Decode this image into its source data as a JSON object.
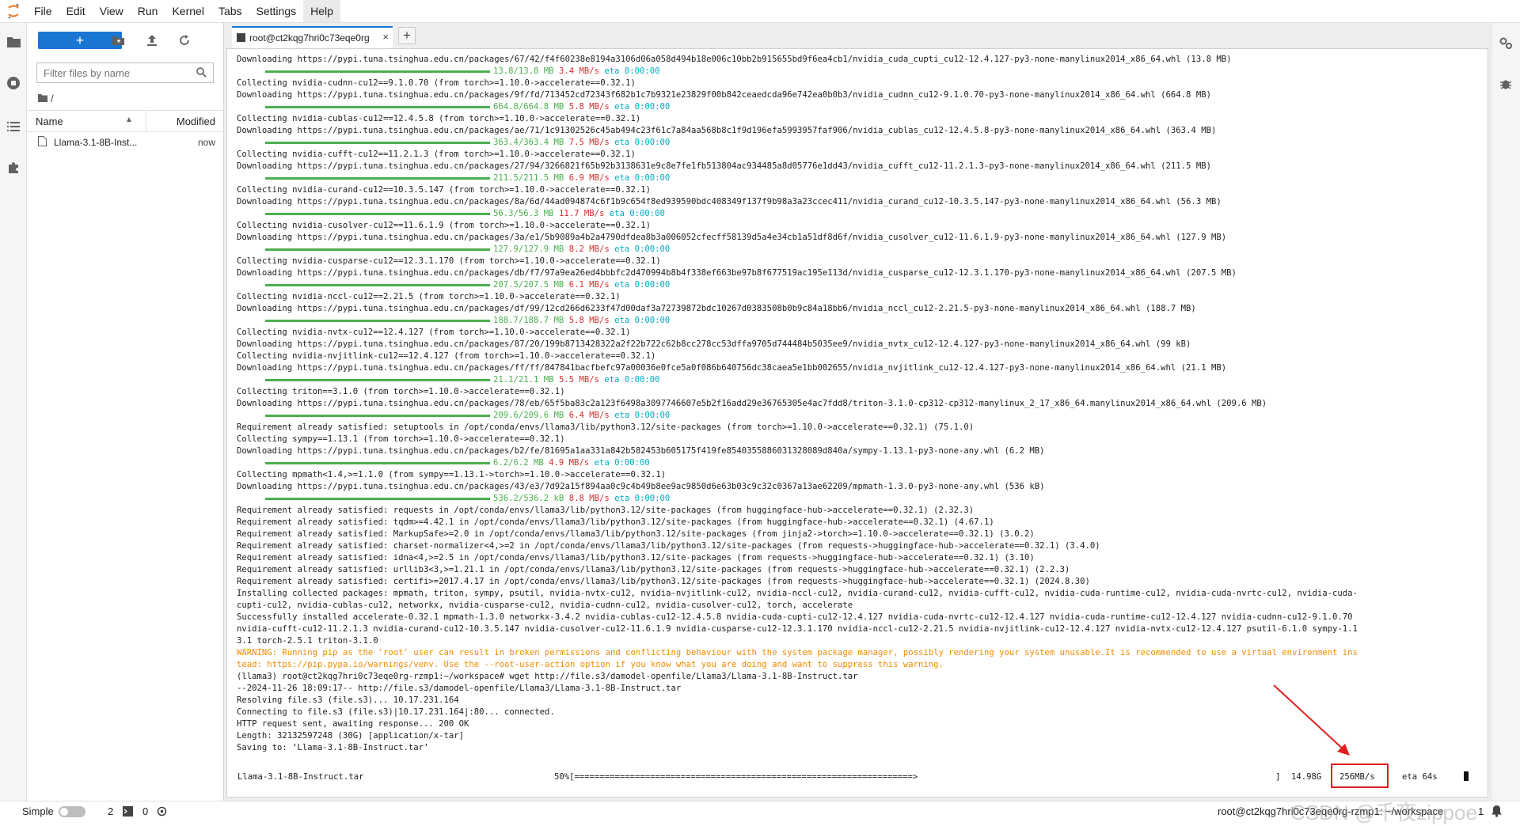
{
  "menu": [
    "File",
    "Edit",
    "View",
    "Run",
    "Kernel",
    "Tabs",
    "Settings",
    "Help"
  ],
  "menu_active": "Help",
  "filebrowser": {
    "new_label": "+",
    "filter_placeholder": "Filter files by name",
    "breadcrumb": "/",
    "col_name": "Name",
    "col_modified": "Modified",
    "files": [
      {
        "name": "Llama-3.1-8B-Inst...",
        "modified": "now"
      }
    ]
  },
  "tab": {
    "label": "root@ct2kqg7hri0c73eqe0rg",
    "close": "×",
    "add": "+"
  },
  "terminal": {
    "lines": [
      {
        "kind": "t",
        "text": "  Downloading https://pypi.tuna.tsinghua.edu.cn/packages/67/42/f4f60238e8194a3106d06a058d494b18e006c10bb2b915655bd9f6ea4cb1/nvidia_cuda_cupti_cu12-12.4.127-py3-none-manylinux2014_x86_64.whl (13.8 MB)"
      },
      {
        "kind": "bar",
        "size": "13.8/13.8 MB",
        "speed": "3.4 MB/s",
        "eta": "eta 0:00:00"
      },
      {
        "kind": "t",
        "text": "Collecting nvidia-cudnn-cu12==9.1.0.70 (from torch>=1.10.0->accelerate==0.32.1)"
      },
      {
        "kind": "t",
        "text": "  Downloading https://pypi.tuna.tsinghua.edu.cn/packages/9f/fd/713452cd72343f682b1c7b9321e23829f00b842ceaedcda96e742ea0b0b3/nvidia_cudnn_cu12-9.1.0.70-py3-none-manylinux2014_x86_64.whl (664.8 MB)"
      },
      {
        "kind": "bar",
        "size": "664.8/664.8 MB",
        "speed": "5.8 MB/s",
        "eta": "eta 0:00:00"
      },
      {
        "kind": "t",
        "text": "Collecting nvidia-cublas-cu12==12.4.5.8 (from torch>=1.10.0->accelerate==0.32.1)"
      },
      {
        "kind": "t",
        "text": "  Downloading https://pypi.tuna.tsinghua.edu.cn/packages/ae/71/1c91302526c45ab494c23f61c7a84aa568b8c1f9d196efa5993957faf906/nvidia_cublas_cu12-12.4.5.8-py3-none-manylinux2014_x86_64.whl (363.4 MB)"
      },
      {
        "kind": "bar",
        "size": "363.4/363.4 MB",
        "speed": "7.5 MB/s",
        "eta": "eta 0:00:00"
      },
      {
        "kind": "t",
        "text": "Collecting nvidia-cufft-cu12==11.2.1.3 (from torch>=1.10.0->accelerate==0.32.1)"
      },
      {
        "kind": "t",
        "text": "  Downloading https://pypi.tuna.tsinghua.edu.cn/packages/27/94/3266821f65b92b3138631e9c8e7fe1fb513804ac934485a8d05776e1dd43/nvidia_cufft_cu12-11.2.1.3-py3-none-manylinux2014_x86_64.whl (211.5 MB)"
      },
      {
        "kind": "bar",
        "size": "211.5/211.5 MB",
        "speed": "6.9 MB/s",
        "eta": "eta 0:00:00"
      },
      {
        "kind": "t",
        "text": "Collecting nvidia-curand-cu12==10.3.5.147 (from torch>=1.10.0->accelerate==0.32.1)"
      },
      {
        "kind": "t",
        "text": "  Downloading https://pypi.tuna.tsinghua.edu.cn/packages/8a/6d/44ad094874c6f1b9c654f8ed939590bdc408349f137f9b98a3a23ccec411/nvidia_curand_cu12-10.3.5.147-py3-none-manylinux2014_x86_64.whl (56.3 MB)"
      },
      {
        "kind": "bar",
        "size": "56.3/56.3 MB",
        "speed": "11.7 MB/s",
        "eta": "eta 0:00:00"
      },
      {
        "kind": "t",
        "text": "Collecting nvidia-cusolver-cu12==11.6.1.9 (from torch>=1.10.0->accelerate==0.32.1)"
      },
      {
        "kind": "t",
        "text": "  Downloading https://pypi.tuna.tsinghua.edu.cn/packages/3a/e1/5b9089a4b2a4790dfdea8b3a006052cfecff58139d5a4e34cb1a51df8d6f/nvidia_cusolver_cu12-11.6.1.9-py3-none-manylinux2014_x86_64.whl (127.9 MB)"
      },
      {
        "kind": "bar",
        "size": "127.9/127.9 MB",
        "speed": "8.2 MB/s",
        "eta": "eta 0:00:00"
      },
      {
        "kind": "t",
        "text": "Collecting nvidia-cusparse-cu12==12.3.1.170 (from torch>=1.10.0->accelerate==0.32.1)"
      },
      {
        "kind": "t",
        "text": "  Downloading https://pypi.tuna.tsinghua.edu.cn/packages/db/f7/97a9ea26ed4bbbfc2d470994b8b4f338ef663be97b8f677519ac195e113d/nvidia_cusparse_cu12-12.3.1.170-py3-none-manylinux2014_x86_64.whl (207.5 MB)"
      },
      {
        "kind": "bar",
        "size": "207.5/207.5 MB",
        "speed": "6.1 MB/s",
        "eta": "eta 0:00:00"
      },
      {
        "kind": "t",
        "text": "Collecting nvidia-nccl-cu12==2.21.5 (from torch>=1.10.0->accelerate==0.32.1)"
      },
      {
        "kind": "t",
        "text": "  Downloading https://pypi.tuna.tsinghua.edu.cn/packages/df/99/12cd266d6233f47d00daf3a72739872bdc10267d0383508b0b9c84a18bb6/nvidia_nccl_cu12-2.21.5-py3-none-manylinux2014_x86_64.whl (188.7 MB)"
      },
      {
        "kind": "bar",
        "size": "188.7/188.7 MB",
        "speed": "5.8 MB/s",
        "eta": "eta 0:00:00"
      },
      {
        "kind": "t",
        "text": "Collecting nvidia-nvtx-cu12==12.4.127 (from torch>=1.10.0->accelerate==0.32.1)"
      },
      {
        "kind": "t",
        "text": "  Downloading https://pypi.tuna.tsinghua.edu.cn/packages/87/20/199b8713428322a2f22b722c62b8cc278cc53dffa9705d744484b5035ee9/nvidia_nvtx_cu12-12.4.127-py3-none-manylinux2014_x86_64.whl (99 kB)"
      },
      {
        "kind": "t",
        "text": "Collecting nvidia-nvjitlink-cu12==12.4.127 (from torch>=1.10.0->accelerate==0.32.1)"
      },
      {
        "kind": "t",
        "text": "  Downloading https://pypi.tuna.tsinghua.edu.cn/packages/ff/ff/847841bacfbefc97a00036e0fce5a0f086b640756dc38caea5e1bb002655/nvidia_nvjitlink_cu12-12.4.127-py3-none-manylinux2014_x86_64.whl (21.1 MB)"
      },
      {
        "kind": "bar",
        "size": "21.1/21.1 MB",
        "speed": "5.5 MB/s",
        "eta": "eta 0:00:00"
      },
      {
        "kind": "t",
        "text": "Collecting triton==3.1.0 (from torch>=1.10.0->accelerate==0.32.1)"
      },
      {
        "kind": "t",
        "text": "  Downloading https://pypi.tuna.tsinghua.edu.cn/packages/78/eb/65f5ba83c2a123f6498a3097746607e5b2f16add29e36765305e4ac7fdd8/triton-3.1.0-cp312-cp312-manylinux_2_17_x86_64.manylinux2014_x86_64.whl (209.6 MB)"
      },
      {
        "kind": "bar",
        "size": "209.6/209.6 MB",
        "speed": "6.4 MB/s",
        "eta": "eta 0:00:00"
      },
      {
        "kind": "t",
        "text": "Requirement already satisfied: setuptools in /opt/conda/envs/llama3/lib/python3.12/site-packages (from torch>=1.10.0->accelerate==0.32.1) (75.1.0)"
      },
      {
        "kind": "t",
        "text": "Collecting sympy==1.13.1 (from torch>=1.10.0->accelerate==0.32.1)"
      },
      {
        "kind": "t",
        "text": "  Downloading https://pypi.tuna.tsinghua.edu.cn/packages/b2/fe/81695a1aa331a842b582453b605175f419fe8540355886031328089d840a/sympy-1.13.1-py3-none-any.whl (6.2 MB)"
      },
      {
        "kind": "bar",
        "size": "6.2/6.2 MB",
        "speed": "4.9 MB/s",
        "eta": "eta 0:00:00"
      },
      {
        "kind": "t",
        "text": "Collecting mpmath<1.4,>=1.1.0 (from sympy==1.13.1->torch>=1.10.0->accelerate==0.32.1)"
      },
      {
        "kind": "t",
        "text": "  Downloading https://pypi.tuna.tsinghua.edu.cn/packages/43/e3/7d92a15f894aa0c9c4b49b8ee9ac9850d6e63b03c9c32c0367a13ae62209/mpmath-1.3.0-py3-none-any.whl (536 kB)"
      },
      {
        "kind": "bar",
        "size": "536.2/536.2 kB",
        "speed": "8.8 MB/s",
        "eta": "eta 0:00:00"
      },
      {
        "kind": "t",
        "text": "Requirement already satisfied: requests in /opt/conda/envs/llama3/lib/python3.12/site-packages (from huggingface-hub->accelerate==0.32.1) (2.32.3)"
      },
      {
        "kind": "t",
        "text": "Requirement already satisfied: tqdm>=4.42.1 in /opt/conda/envs/llama3/lib/python3.12/site-packages (from huggingface-hub->accelerate==0.32.1) (4.67.1)"
      },
      {
        "kind": "t",
        "text": "Requirement already satisfied: MarkupSafe>=2.0 in /opt/conda/envs/llama3/lib/python3.12/site-packages (from jinja2->torch>=1.10.0->accelerate==0.32.1) (3.0.2)"
      },
      {
        "kind": "t",
        "text": "Requirement already satisfied: charset-normalizer<4,>=2 in /opt/conda/envs/llama3/lib/python3.12/site-packages (from requests->huggingface-hub->accelerate==0.32.1) (3.4.0)"
      },
      {
        "kind": "t",
        "text": "Requirement already satisfied: idna<4,>=2.5 in /opt/conda/envs/llama3/lib/python3.12/site-packages (from requests->huggingface-hub->accelerate==0.32.1) (3.10)"
      },
      {
        "kind": "t",
        "text": "Requirement already satisfied: urllib3<3,>=1.21.1 in /opt/conda/envs/llama3/lib/python3.12/site-packages (from requests->huggingface-hub->accelerate==0.32.1) (2.2.3)"
      },
      {
        "kind": "t",
        "text": "Requirement already satisfied: certifi>=2017.4.17 in /opt/conda/envs/llama3/lib/python3.12/site-packages (from requests->huggingface-hub->accelerate==0.32.1) (2024.8.30)"
      },
      {
        "kind": "t",
        "text": "Installing collected packages: mpmath, triton, sympy, psutil, nvidia-nvtx-cu12, nvidia-nvjitlink-cu12, nvidia-nccl-cu12, nvidia-curand-cu12, nvidia-cufft-cu12, nvidia-cuda-runtime-cu12, nvidia-cuda-nvrtc-cu12, nvidia-cuda-"
      },
      {
        "kind": "t",
        "text": "cupti-cu12, nvidia-cublas-cu12, networkx, nvidia-cusparse-cu12, nvidia-cudnn-cu12, nvidia-cusolver-cu12, torch, accelerate"
      },
      {
        "kind": "t",
        "text": "Successfully installed accelerate-0.32.1 mpmath-1.3.0 networkx-3.4.2 nvidia-cublas-cu12-12.4.5.8 nvidia-cuda-cupti-cu12-12.4.127 nvidia-cuda-nvrtc-cu12-12.4.127 nvidia-cuda-runtime-cu12-12.4.127 nvidia-cudnn-cu12-9.1.0.70"
      },
      {
        "kind": "t",
        "text": "nvidia-cufft-cu12-11.2.1.3 nvidia-curand-cu12-10.3.5.147 nvidia-cusolver-cu12-11.6.1.9 nvidia-cusparse-cu12-12.3.1.170 nvidia-nccl-cu12-2.21.5 nvidia-nvjitlink-cu12-12.4.127 nvidia-nvtx-cu12-12.4.127 psutil-6.1.0 sympy-1.1"
      },
      {
        "kind": "t",
        "text": "3.1 torch-2.5.1 triton-3.1.0"
      },
      {
        "kind": "w",
        "text": "WARNING: Running pip as the 'root' user can result in broken permissions and conflicting behaviour with the system package manager, possibly rendering your system unusable.It is recommended to use a virtual environment ins"
      },
      {
        "kind": "w",
        "text": "tead: https://pip.pypa.io/warnings/venv. Use the --root-user-action option if you know what you are doing and want to suppress this warning."
      },
      {
        "kind": "t",
        "text": "(llama3) root@ct2kqg7hri0c73eqe0rg-rzmp1:~/workspace# wget http://file.s3/damodel-openfile/Llama3/Llama-3.1-8B-Instruct.tar"
      },
      {
        "kind": "t",
        "text": "--2024-11-26 18:09:17--  http://file.s3/damodel-openfile/Llama3/Llama-3.1-8B-Instruct.tar"
      },
      {
        "kind": "t",
        "text": "Resolving file.s3 (file.s3)... 10.17.231.164"
      },
      {
        "kind": "t",
        "text": "Connecting to file.s3 (file.s3)|10.17.231.164|:80... connected."
      },
      {
        "kind": "t",
        "text": "HTTP request sent, awaiting response... 200 OK"
      },
      {
        "kind": "t",
        "text": "Length: 32132597248 (30G) [application/x-tar]"
      },
      {
        "kind": "t",
        "text": "Saving to: ‘Llama-3.1-8B-Instruct.tar’"
      }
    ],
    "progress": {
      "file": "Llama-3.1-8B-Instruct.tar",
      "percent": "50%[===================================================================>",
      "bracket": "]",
      "size": "14.98G",
      "speed": "256MB/s",
      "eta": "eta 64s"
    }
  },
  "statusbar": {
    "mode": "Simple",
    "terminals": "2",
    "kernels": "0",
    "right": "root@ct2kqg7hri0c73eqe0rg-rzmp1: ~/workspace",
    "count": "1"
  },
  "watermark": "CSDN @千夜zippoe",
  "colors": {
    "accent": "#1976d2",
    "progress": "#4caf50",
    "speed": "#d32f2f",
    "eta": "#00acc1",
    "warning": "#f08c00",
    "highlight": "#e02020"
  }
}
